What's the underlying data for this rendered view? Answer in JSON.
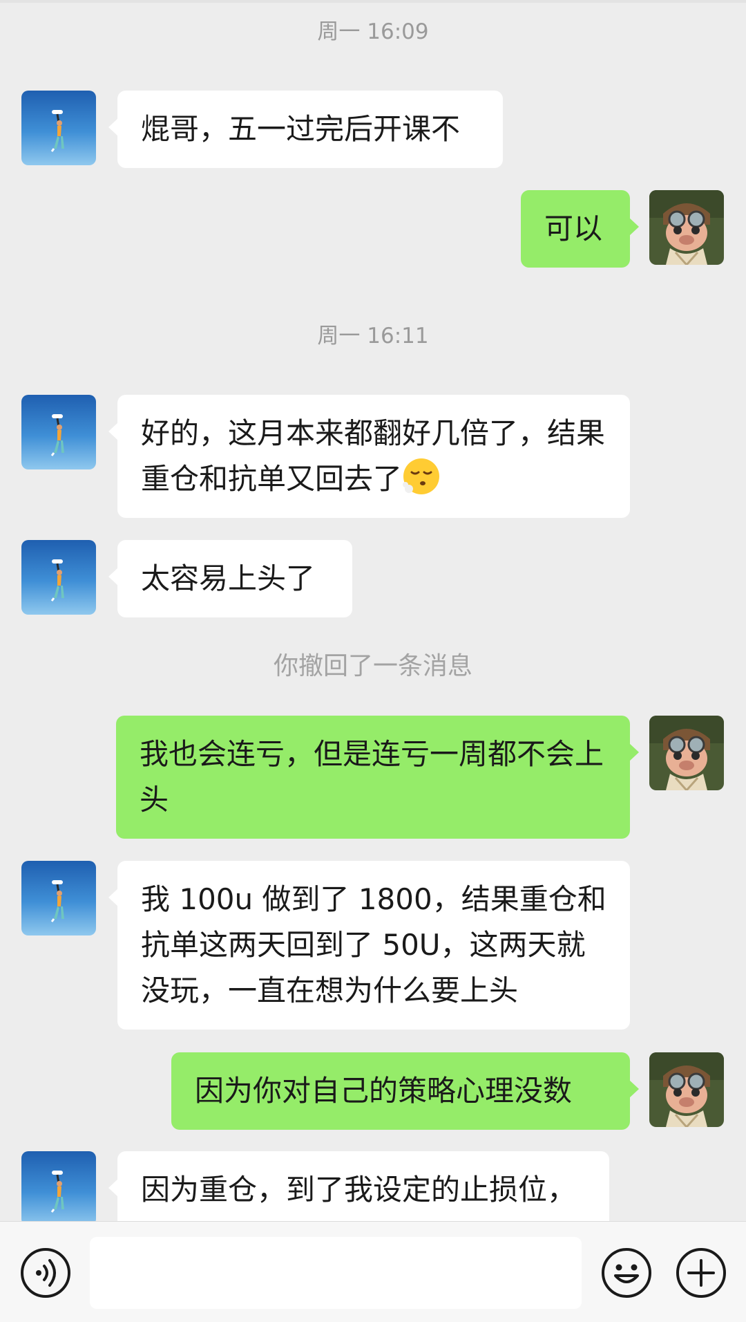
{
  "timestamps": [
    "周一 16:09",
    "周一 16:11"
  ],
  "notices": [
    "你撤回了一条消息"
  ],
  "messages": [
    {
      "side": "in",
      "text": "焜哥，五一过完后开课不"
    },
    {
      "side": "out",
      "text": "可以"
    },
    {
      "side": "in",
      "text": "好的，这月本来都翻好几倍了，结果重仓和抗单又回去了",
      "emoji": "sigh-face-emoji"
    },
    {
      "side": "in",
      "text": "太容易上头了"
    },
    {
      "side": "out",
      "text": "我也会连亏，但是连亏一周都不会上头"
    },
    {
      "side": "in",
      "text": "我 100u 做到了 1800，结果重仓和抗单这两天回到了 50U，这两天就没玩，一直在想为什么要上头"
    },
    {
      "side": "out",
      "text": "因为你对自己的策略心理没数"
    },
    {
      "side": "in",
      "text": "因为重仓，到了我设定的止损位，"
    }
  ],
  "input_bar": {
    "value": "",
    "icons": [
      "voice-icon",
      "emoji-icon",
      "plus-icon"
    ]
  },
  "colors": {
    "background": "#ededed",
    "incoming_bubble": "#ffffff",
    "outgoing_bubble": "#95ec69",
    "toolbar": "#f7f7f7"
  },
  "avatars": {
    "contact": "skydiver-avatar",
    "self": "aviator-pig-avatar"
  }
}
